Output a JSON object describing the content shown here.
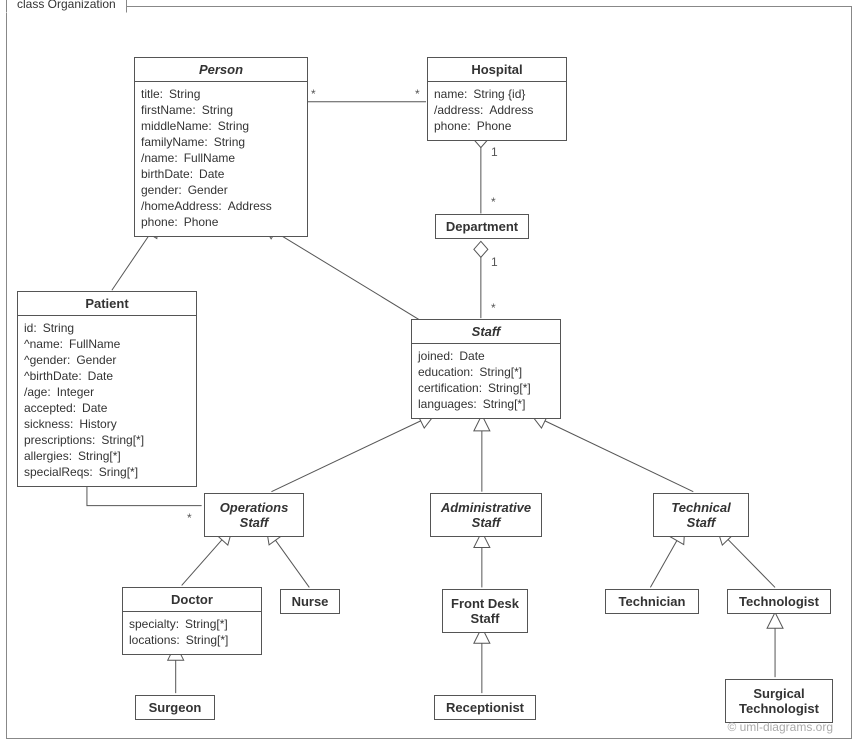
{
  "frame": {
    "title": "class Organization"
  },
  "classes": {
    "person": {
      "name": "Person",
      "attrs": [
        {
          "name": "title:",
          "type": "String"
        },
        {
          "name": "firstName:",
          "type": "String"
        },
        {
          "name": "middleName:",
          "type": "String"
        },
        {
          "name": "familyName:",
          "type": "String"
        },
        {
          "name": "/name:",
          "type": "FullName"
        },
        {
          "name": "birthDate:",
          "type": "Date"
        },
        {
          "name": "gender:",
          "type": "Gender"
        },
        {
          "name": "/homeAddress:",
          "type": "Address"
        },
        {
          "name": "phone:",
          "type": "Phone"
        }
      ]
    },
    "hospital": {
      "name": "Hospital",
      "attrs": [
        {
          "name": "name:",
          "type": "String {id}"
        },
        {
          "name": "/address:",
          "type": "Address"
        },
        {
          "name": "phone:",
          "type": "Phone"
        }
      ]
    },
    "department": {
      "name": "Department"
    },
    "patient": {
      "name": "Patient",
      "attrs": [
        {
          "name": "id:",
          "type": "String"
        },
        {
          "name": "^name:",
          "type": "FullName"
        },
        {
          "name": "^gender:",
          "type": "Gender"
        },
        {
          "name": "^birthDate:",
          "type": "Date"
        },
        {
          "name": "/age:",
          "type": "Integer"
        },
        {
          "name": "accepted:",
          "type": "Date"
        },
        {
          "name": "sickness:",
          "type": "History"
        },
        {
          "name": "prescriptions:",
          "type": "String[*]"
        },
        {
          "name": "allergies:",
          "type": "String[*]"
        },
        {
          "name": "specialReqs:",
          "type": "Sring[*]"
        }
      ]
    },
    "staff": {
      "name": "Staff",
      "attrs": [
        {
          "name": "joined:",
          "type": "Date"
        },
        {
          "name": "education:",
          "type": "String[*]"
        },
        {
          "name": "certification:",
          "type": "String[*]"
        },
        {
          "name": "languages:",
          "type": "String[*]"
        }
      ]
    },
    "opstaff": {
      "name": "Operations Staff"
    },
    "adminstaff": {
      "name": "Administrative Staff"
    },
    "techstaff": {
      "name": "Technical Staff"
    },
    "doctor": {
      "name": "Doctor",
      "attrs": [
        {
          "name": "specialty:",
          "type": "String[*]"
        },
        {
          "name": "locations:",
          "type": "String[*]"
        }
      ]
    },
    "nurse": {
      "name": "Nurse"
    },
    "frontdesk": {
      "name": "Front Desk Staff"
    },
    "receptionist": {
      "name": "Receptionist"
    },
    "technician": {
      "name": "Technician"
    },
    "technologist": {
      "name": "Technologist"
    },
    "surgtech": {
      "name": "Surgical Technologist"
    },
    "surgeon": {
      "name": "Surgeon"
    }
  },
  "multiplicities": {
    "person_hospital_left": "*",
    "person_hospital_right": "*",
    "hosp_dept_one": "1",
    "hosp_dept_many": "*",
    "dept_staff_one": "1",
    "dept_staff_many": "*",
    "patient_ops_left": "*",
    "patient_ops_right": "*"
  },
  "watermark": "© uml-diagrams.org"
}
